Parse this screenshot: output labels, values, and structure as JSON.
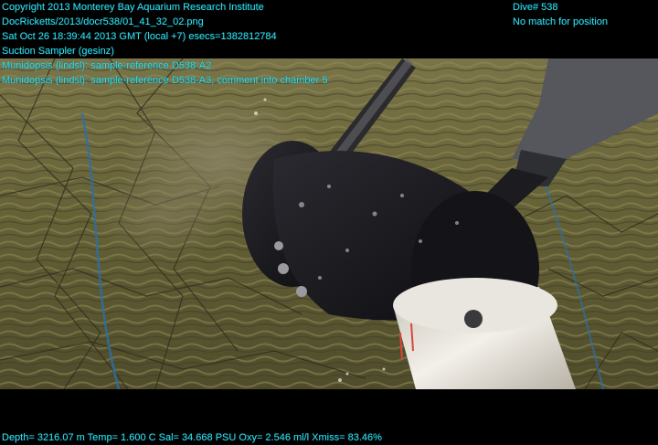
{
  "overlay": {
    "top_left_lines": [
      "Copyright 2013 Monterey Bay Aquarium Research Institute",
      "DocRicketts/2013/docr538/01_41_32_02.png",
      "Sat Oct 26 18:39:44 2013 GMT (local +7)  esecs=1382812784",
      "Suction Sampler (gesinz)",
      "Munidopsis (lindsl): sample-reference D538-A2",
      "Munidopsis (lindsl): sample-reference D538-A3, comment into chamber 5"
    ],
    "top_right_lines": [
      "Dive# 538",
      "No match for position"
    ],
    "bottom_line": "Depth= 3216.07 m  Temp= 1.600 C  Sal= 34.668 PSU  Oxy= 2.546 ml/l  Xmiss= 83.46%"
  },
  "colors": {
    "overlay_text": "#2fe0f0",
    "background": "#000000",
    "seafloor": "#6b6a3a",
    "sampler_body": "#1a1a1f",
    "pipe": "#e8e4dc"
  }
}
